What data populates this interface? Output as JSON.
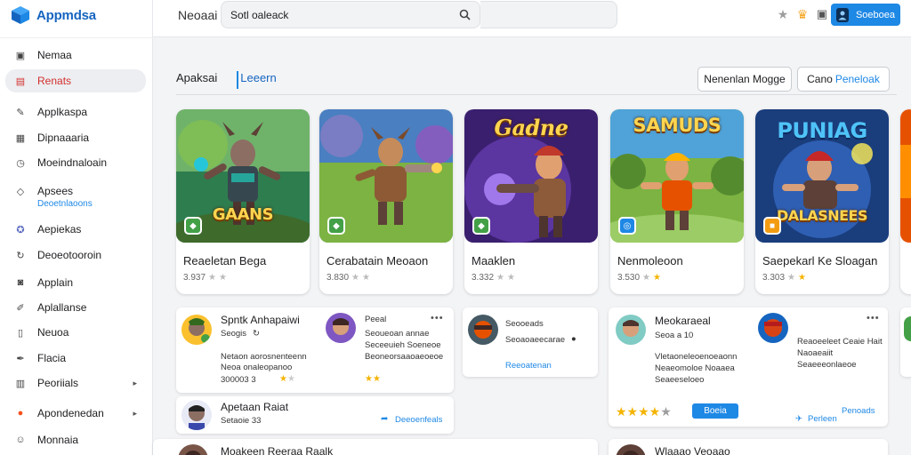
{
  "app": {
    "logo_text": "Appmdsa"
  },
  "sidebar": {
    "items": [
      {
        "label": "Nemaa",
        "icon": "briefcase-icon"
      },
      {
        "label": "Renats",
        "icon": "bag-icon",
        "active": true
      },
      {
        "label": "Applkaspa",
        "icon": "pencil-icon"
      },
      {
        "label": "Dipnaaaria",
        "icon": "box-icon"
      },
      {
        "label": "Moeindnaloain",
        "icon": "clock-icon"
      },
      {
        "label": "Apsees",
        "sub": "Deoetnlaoons",
        "icon": "diamond-icon"
      },
      {
        "label": "Aepiekas",
        "icon": "gamepad-icon"
      },
      {
        "label": "Deoeotooroin",
        "icon": "refresh-icon"
      },
      {
        "label": "Applain",
        "icon": "camera-icon"
      },
      {
        "label": "Aplallanse",
        "icon": "wand-icon"
      },
      {
        "label": "Neuoa",
        "icon": "document-icon"
      },
      {
        "label": "Flacia",
        "icon": "pen-icon"
      },
      {
        "label": "Peoriials",
        "icon": "table-icon",
        "chevron": "▸"
      },
      {
        "label": "Apondenedan",
        "icon": "fire-icon",
        "chevron": "▸"
      },
      {
        "label": "Monnaia",
        "icon": "person-icon"
      }
    ]
  },
  "topbar": {
    "title": "Neoaai",
    "search_value": "Sotl oaleack",
    "user_button": "Soeboea"
  },
  "tabs": [
    "Apaksai",
    "Leeern"
  ],
  "buttons": {
    "left": "Nenenlan Mogge",
    "right_prefix": "Cano",
    "right_blue": "Peneloak"
  },
  "games": [
    {
      "name": "Reaeletan Bega",
      "meta": "3.937",
      "art_title": "GAANS",
      "badge_color": "#43a047"
    },
    {
      "name": "Cerabatain Meoaon",
      "meta": "3.830",
      "art_title": "",
      "badge_color": "#43a047"
    },
    {
      "name": "Maaklen",
      "meta": "3.332",
      "art_title": "Gadne",
      "badge_color": "#43a047"
    },
    {
      "name": "Nenmoleoon",
      "meta": "3.530",
      "art_title": "SAMUDS",
      "badge_color": "#1e88e5"
    },
    {
      "name": "Saepekarl Ke Sloagan",
      "meta": "3.303",
      "art_title": "PUNIAG",
      "art_subtitle": "DALASNEES",
      "badge_color": "#f39c12"
    }
  ],
  "reviews": {
    "r1": {
      "name": "Spntk Anhapaiwi",
      "handle": "Seogis",
      "lines": [
        "Netaon aorosnenteenn",
        "Neoa onaleopanoo"
      ],
      "footer": "300003 3"
    },
    "r1b": {
      "name": "Peeal",
      "lines": [
        "Seoueoan annae",
        "Seceeuieh Soeneoe",
        "Beoneorsaaoaeoeoe"
      ]
    },
    "r2": {
      "name": "Apetaan Raiat",
      "sub": "Setaoie 33",
      "link": "Deeoenfeals"
    },
    "r3": {
      "head": "Seooeads",
      "line": "Seoaoaeecarae",
      "link": "Reeoatenan"
    },
    "r4": {
      "name": "Meokaraeal",
      "handle": "Seoa a 10",
      "lines": [
        "Vletaoneleoenoeaonn",
        "Neaeomoloe Noaaea",
        "Seaeeseloeo"
      ],
      "button": "Boeia"
    },
    "r4b": {
      "lines": [
        "Reaoeeleet Ceaie Hait",
        "Naoaeaiit",
        "Seaeeeonlaeoe"
      ],
      "link": "Penoads",
      "link2": "Perleen"
    },
    "r5": {
      "name": "Moakeen Reeraa Raalk"
    },
    "r6": {
      "name": "Wlaaao Veoaao"
    }
  },
  "colors": {
    "accent": "#1e88e5",
    "active_nav": "#d32f2f",
    "star": "#f5b400"
  }
}
